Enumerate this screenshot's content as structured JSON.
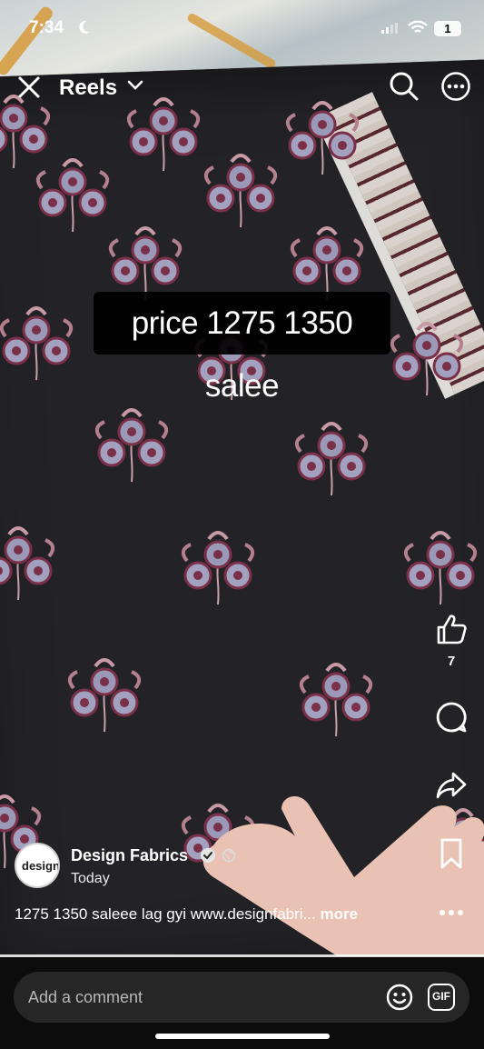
{
  "status_bar": {
    "time": "7:34",
    "battery": "1"
  },
  "header": {
    "title": "Reels"
  },
  "video": {
    "overlay_text": "price 1275 1350 salee"
  },
  "actions": {
    "like_count": "7"
  },
  "post": {
    "username": "Design Fabrics",
    "date": "Today",
    "caption": "1275 1350 saleee lag gyi www.designfabri...",
    "more_label": "more",
    "avatar_text": "design"
  },
  "comment": {
    "placeholder": "Add a comment",
    "gif_label": "GIF"
  }
}
